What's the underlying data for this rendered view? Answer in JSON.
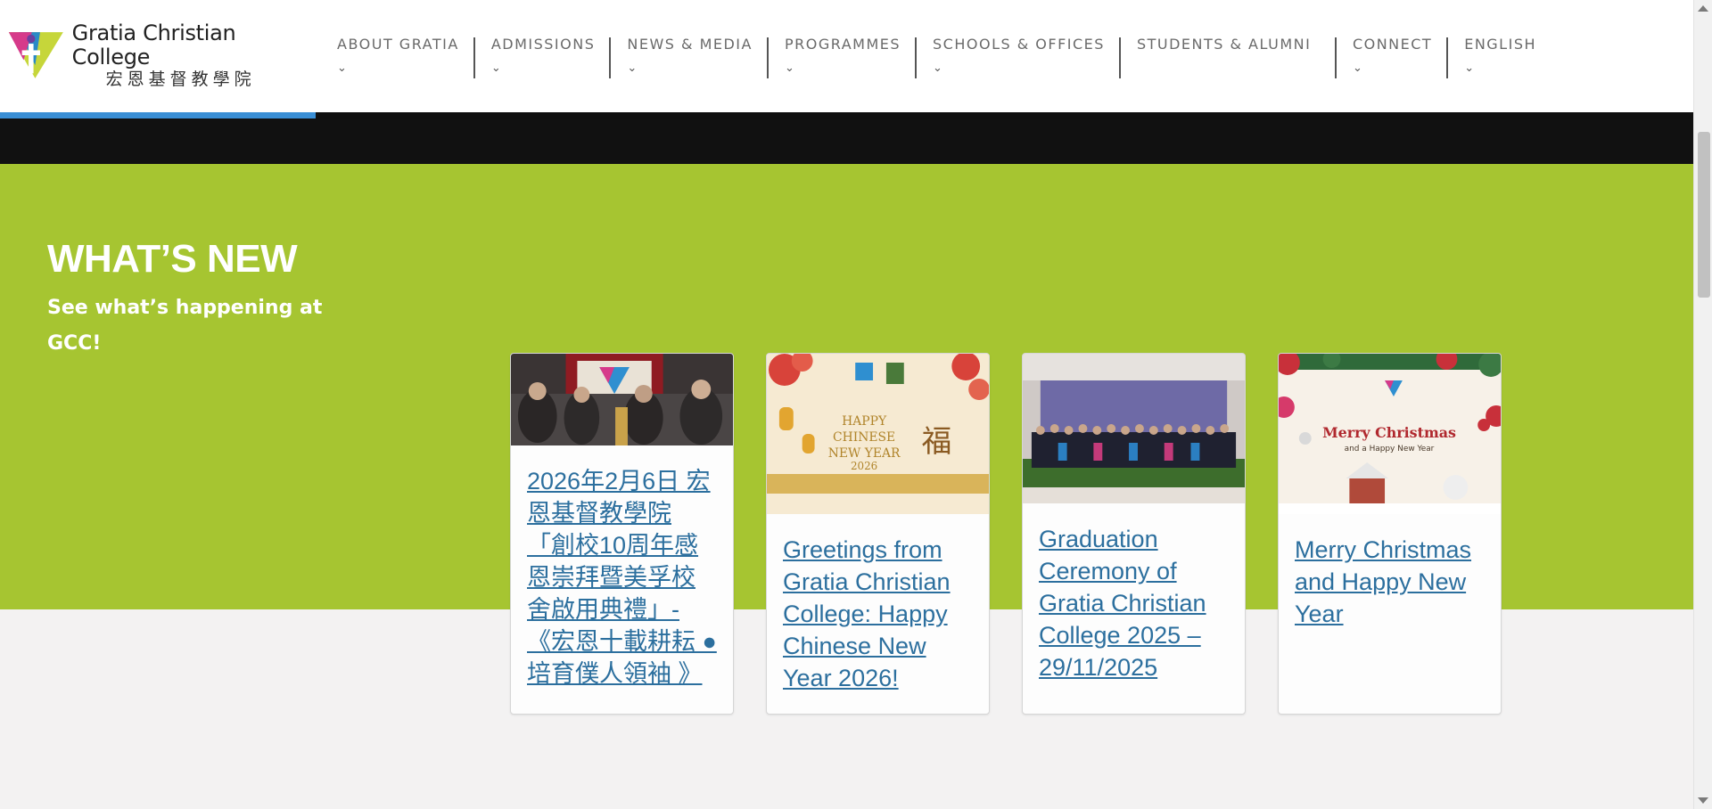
{
  "logo": {
    "name_en": "Gratia Christian College",
    "name_zh": "宏恩基督教學院"
  },
  "nav": {
    "items": [
      {
        "label": "ABOUT GRATIA",
        "chevron": "⌄"
      },
      {
        "label": "ADMISSIONS",
        "chevron": "⌄"
      },
      {
        "label": "NEWS & MEDIA",
        "chevron": "⌄"
      },
      {
        "label": "PROGRAMMES",
        "chevron": "⌄"
      },
      {
        "label": "SCHOOLS & OFFICES",
        "chevron": "⌄"
      },
      {
        "label": "STUDENTS & ALUMNI",
        "chevron": ""
      },
      {
        "label": "CONNECT",
        "chevron": "⌄"
      },
      {
        "label": "ENGLISH",
        "chevron": "⌄"
      }
    ]
  },
  "whats_new": {
    "title": "WHAT’S NEW",
    "subtitle": "See what’s happening at GCC!",
    "cards": [
      {
        "title": "2026年2月6日 宏恩基督教學院「創校10周年感恩崇拜暨美孚校舍啟用典禮」-《宏恩十載耕耘 ● 培育僕人領袖 》",
        "thumb_icon": "ceremony-photo"
      },
      {
        "title": "Greetings from Gratia Christian College: Happy Chinese New Year 2026!",
        "thumb_icon": "chinese-new-year-card",
        "thumb_text": "HAPPY CHINESE NEW YEAR 2026"
      },
      {
        "title": "Graduation Ceremony of Gratia Christian College 2025 – 29/11/2025",
        "thumb_icon": "graduation-group-photo"
      },
      {
        "title": "Merry Christmas and Happy New Year",
        "thumb_icon": "christmas-card",
        "thumb_text": "Merry Christmas and a Happy New Year"
      }
    ]
  },
  "colors": {
    "green": "#a6c531",
    "link": "#2c6f9e",
    "progress": "#3a8fd6"
  }
}
